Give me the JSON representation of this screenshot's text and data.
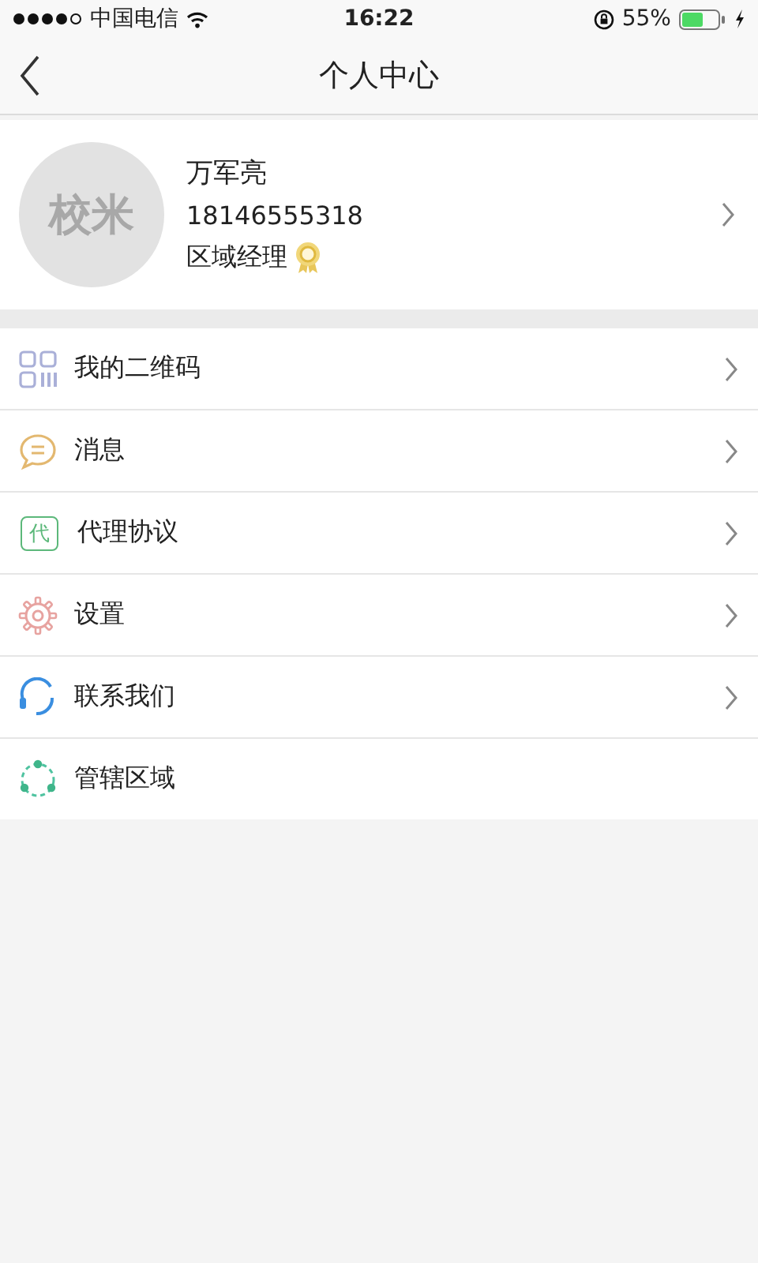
{
  "status_bar": {
    "carrier": "中国电信",
    "time": "16:22",
    "battery": "55%"
  },
  "nav": {
    "title": "个人中心"
  },
  "profile": {
    "avatar_text": "校米",
    "name": "万军亮",
    "phone": "18146555318",
    "role": "区域经理"
  },
  "menu": [
    {
      "kind": "qrcode",
      "label": "我的二维码",
      "chevron": true
    },
    {
      "kind": "message",
      "label": "消息",
      "chevron": true
    },
    {
      "kind": "agent",
      "label": "代理协议",
      "icon_text": "代",
      "chevron": true
    },
    {
      "kind": "settings",
      "label": "设置",
      "chevron": true
    },
    {
      "kind": "contact",
      "label": "联系我们",
      "chevron": true
    },
    {
      "kind": "region",
      "label": "管辖区域",
      "chevron": false
    }
  ]
}
